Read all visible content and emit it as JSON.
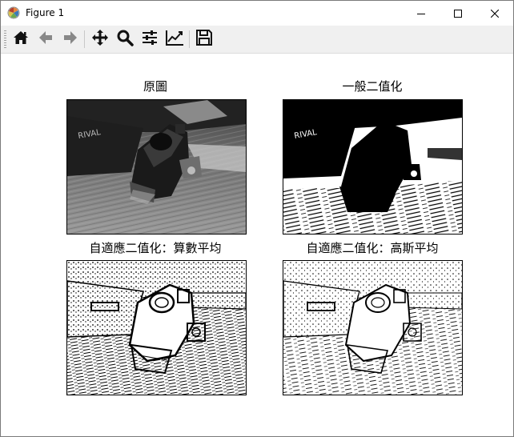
{
  "window": {
    "title": "Figure 1",
    "icon": "matplotlib-logo-icon",
    "controls": [
      "minimize-icon",
      "maximize-icon",
      "close-icon"
    ]
  },
  "toolbar": {
    "buttons": [
      {
        "name": "home",
        "icon": "home-icon",
        "tooltip": "Reset original view"
      },
      {
        "name": "back",
        "icon": "arrow-left-icon",
        "tooltip": "Back to previous view"
      },
      {
        "name": "forward",
        "icon": "arrow-right-icon",
        "tooltip": "Forward to next view"
      },
      {
        "name": "pan",
        "icon": "move-icon",
        "tooltip": "Pan axes"
      },
      {
        "name": "zoom",
        "icon": "magnifier-icon",
        "tooltip": "Zoom to rectangle"
      },
      {
        "name": "subplots",
        "icon": "sliders-icon",
        "tooltip": "Configure subplots"
      },
      {
        "name": "edit",
        "icon": "line-chart-icon",
        "tooltip": "Edit axis, curve and image parameters"
      },
      {
        "name": "save",
        "icon": "floppy-disk-icon",
        "tooltip": "Save the figure"
      }
    ]
  },
  "figure": {
    "subplots": [
      {
        "title": "原圖",
        "image": "grayscale photo of a red dot sight on a table"
      },
      {
        "title": "一般二值化",
        "image": "global threshold binary image"
      },
      {
        "title": "自適應二值化：算數平均",
        "image": "adaptive mean threshold binary image"
      },
      {
        "title": "自適應二值化：高斯平均",
        "image": "adaptive gaussian threshold binary image"
      }
    ]
  }
}
